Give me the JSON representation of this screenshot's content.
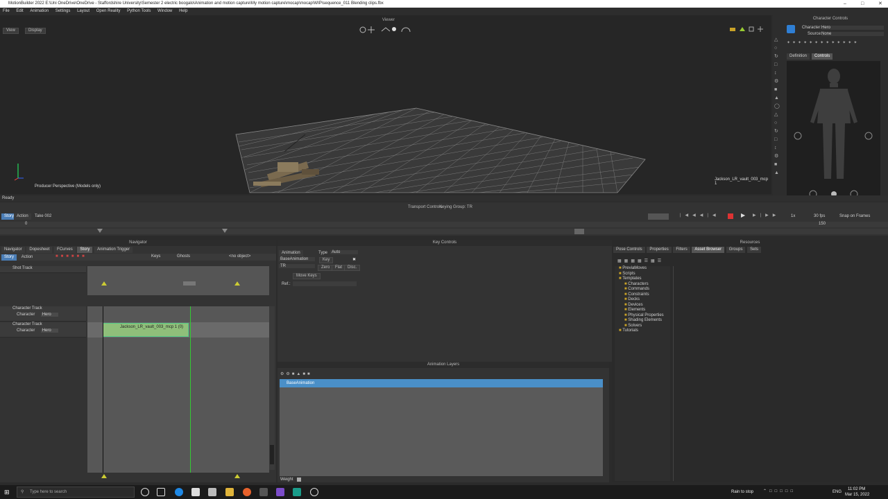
{
  "window": {
    "title": "MotionBuilder 2022    E:\\Uni OneDrive\\OneDrive - Staffordshire University\\Semester 2 electric boogalo\\Animation and motion capture\\My motion capture\\mocap\\mocap\\WIP\\sequence_011 Blending clips.fbx"
  },
  "menu": [
    "File",
    "Edit",
    "Animation",
    "Settings",
    "Layout",
    "Open Reality",
    "Python Tools",
    "Window",
    "Help"
  ],
  "viewer": {
    "title": "Viewer",
    "view_btn": "View",
    "display_btn": "Display",
    "camera_label": "Producer Perspective (Models only)",
    "take_label": "Jackson_LR_vault_003_mcp 1"
  },
  "status": {
    "text": "Ready"
  },
  "transport": {
    "title": "Transport Controls",
    "keying_group": "Keying Group: TR",
    "story_tab": "Story",
    "action_tab": "Action",
    "take": "Take 002",
    "speed": "1x",
    "fps": "30 fps",
    "snap": "Snap on Frames",
    "start_frame": "0",
    "end_frame": "150"
  },
  "navigator": {
    "title": "Navigator",
    "tabs": [
      "Navigator",
      "Dopesheet",
      "FCurves",
      "Story",
      "Animation Trigger"
    ],
    "toolbar": {
      "story": "Story",
      "action": "Action",
      "keys": "Keys",
      "ghosts": "Ghosts",
      "object": "<no object>"
    },
    "tracks": [
      {
        "name": "Shot Track"
      },
      {
        "name": "Character Track",
        "field": "Character",
        "value": "Hero"
      },
      {
        "name": "Character Track",
        "field": "Character",
        "value": "Hero"
      }
    ],
    "clip": {
      "label": "Jackson_LR_vault_003_mcp 1 (0)"
    }
  },
  "key_controls": {
    "title": "Key Controls",
    "animation": "Animation",
    "type_label": "Type",
    "type_value": "Auto",
    "layer": "BaseAnimation",
    "key_btn": "Key",
    "tr": "TR",
    "zero": "Zero",
    "flat": "Flat",
    "disc": "Disc.",
    "move_keys": "Move Keys",
    "ref": "Ref.:"
  },
  "animation_layers": {
    "title": "Animation Layers",
    "layer": "BaseAnimation",
    "weight": "Weight"
  },
  "resources": {
    "title": "Resources",
    "tabs": [
      "Pose Controls",
      "Properties",
      "Filters",
      "Asset Browser",
      "Groups",
      "Sets"
    ],
    "tree": [
      {
        "label": "PreviaMoves",
        "indent": 1
      },
      {
        "label": "Scripts",
        "indent": 1
      },
      {
        "label": "Templates",
        "indent": 1
      },
      {
        "label": "Characters",
        "indent": 2
      },
      {
        "label": "Commands",
        "indent": 2
      },
      {
        "label": "Constraints",
        "indent": 2
      },
      {
        "label": "Decks",
        "indent": 2
      },
      {
        "label": "Devices",
        "indent": 2
      },
      {
        "label": "Elements",
        "indent": 2
      },
      {
        "label": "Physical Properties",
        "indent": 2
      },
      {
        "label": "Shading Elements",
        "indent": 2
      },
      {
        "label": "Solvers",
        "indent": 2
      },
      {
        "label": "Tutorials",
        "indent": 1
      }
    ]
  },
  "character_controls": {
    "title": "Character Controls",
    "character_label": "Character:",
    "character_value": "Hero",
    "source_label": "Source:",
    "source_value": "None",
    "tab_definition": "Definition",
    "tab_controls": "Controls"
  },
  "taskbar": {
    "search": "Type here to search",
    "weather": "Rain to stop",
    "lang": "ENG",
    "time": "11:02 PM",
    "date": "Mar 15, 2022"
  }
}
